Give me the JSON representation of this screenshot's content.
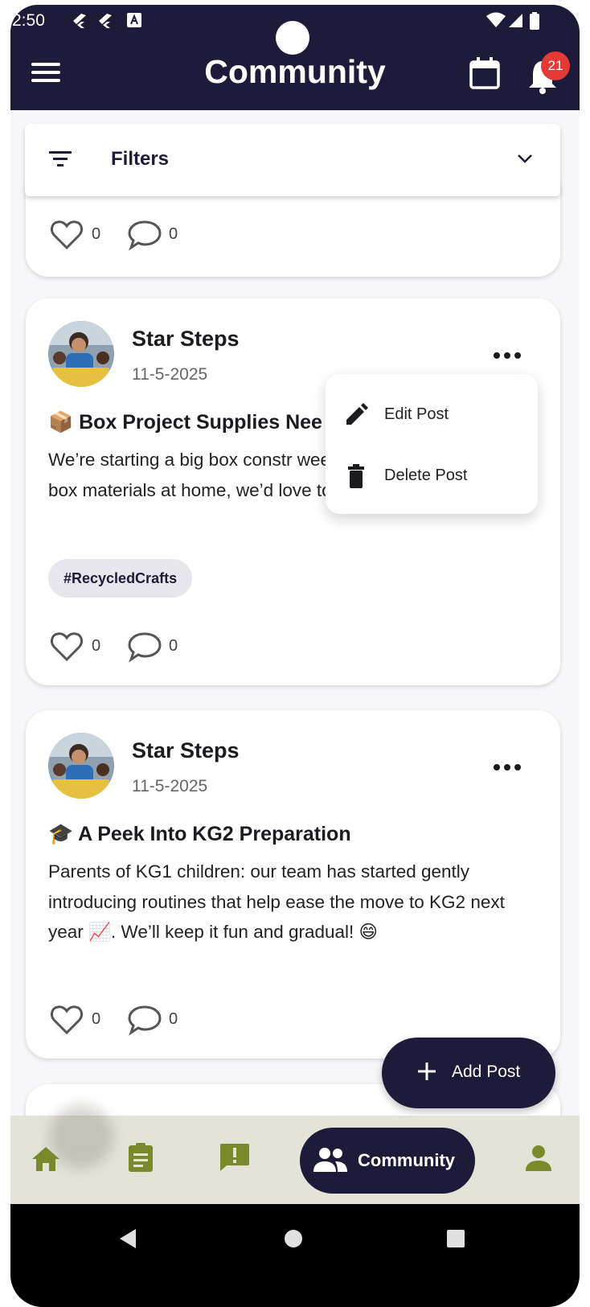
{
  "status_bar": {
    "time": "2:50"
  },
  "app_bar": {
    "title": "Community",
    "notification_count": "21"
  },
  "filters": {
    "label": "Filters"
  },
  "prev_card": {
    "likes": "0",
    "comments": "0"
  },
  "posts": [
    {
      "author": "Star Steps",
      "date": "11-5-2025",
      "title": "📦 Box Project Supplies Nee",
      "body": "We’re starting a big box constr week 🏗️. If you have large box materials at home, we’d love to reuse them! 📦🔧",
      "tag": "#RecycledCrafts",
      "likes": "0",
      "comments": "0"
    },
    {
      "author": "Star Steps",
      "date": "11-5-2025",
      "title": "🎓 A Peek Into KG2 Preparation",
      "body": "Parents of KG1 children: our team has started gently introducing routines that help ease the move to KG2 next year 📈. We’ll keep it fun and gradual! 😄",
      "likes": "0",
      "comments": "0"
    }
  ],
  "context_menu": {
    "edit": "Edit Post",
    "delete": "Delete Post"
  },
  "fab": {
    "label": "Add Post"
  },
  "bottom_nav": {
    "active_label": "Community"
  },
  "colors": {
    "primary": "#1e1b3a",
    "nav_icon": "#7a8a2a",
    "badge": "#e53935"
  }
}
